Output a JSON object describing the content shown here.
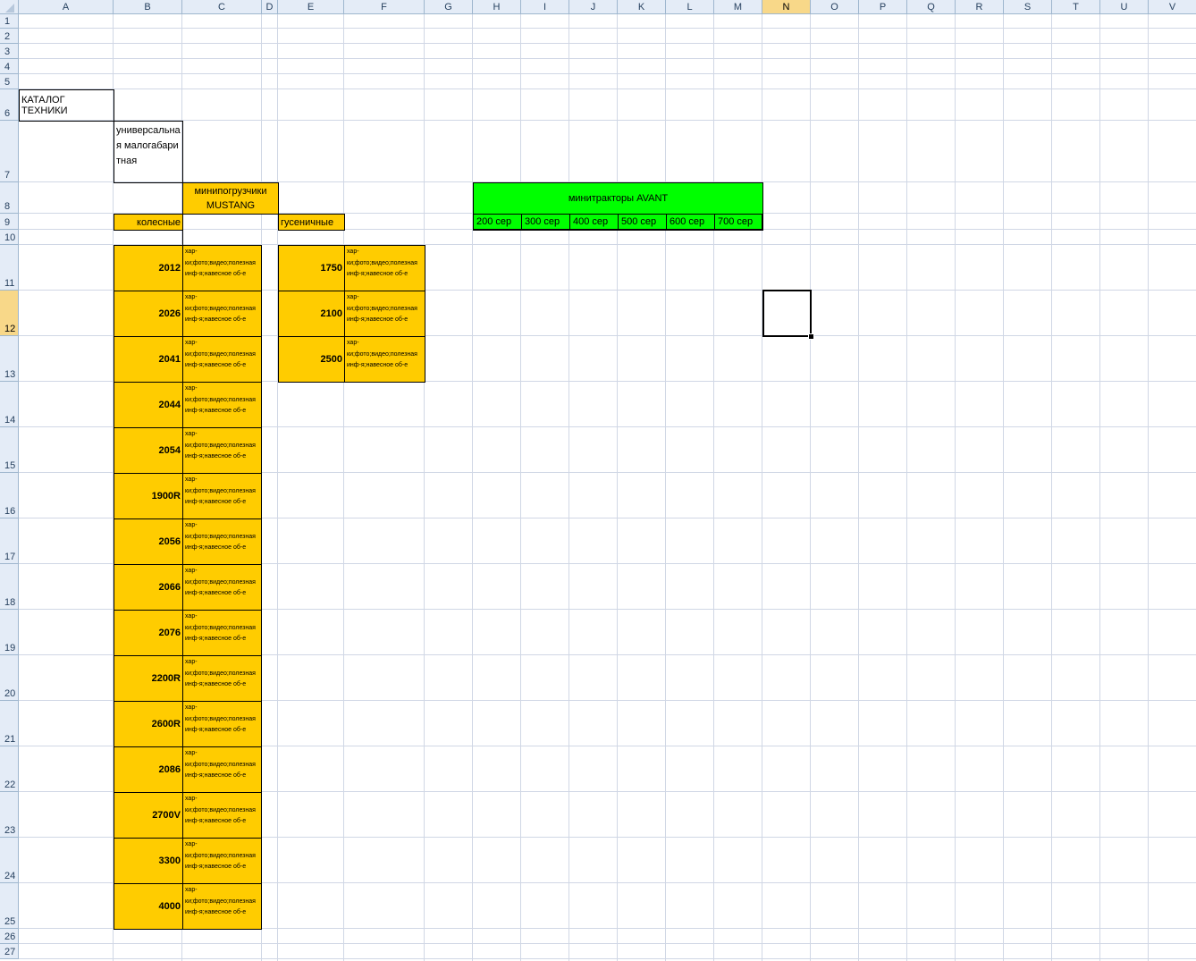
{
  "sheet": {
    "columns": [
      "A",
      "B",
      "C",
      "D",
      "E",
      "F",
      "G",
      "H",
      "I",
      "J",
      "K",
      "L",
      "M",
      "N",
      "O",
      "P",
      "Q",
      "R",
      "S",
      "T",
      "U",
      "V"
    ],
    "rows": [
      "1",
      "2",
      "3",
      "4",
      "5",
      "6",
      "7",
      "8",
      "9",
      "10",
      "11",
      "12",
      "13",
      "14",
      "15",
      "16",
      "17",
      "18",
      "19",
      "20",
      "21",
      "22",
      "23",
      "24",
      "25",
      "26",
      "27"
    ],
    "active_column": "N",
    "active_row": "12"
  },
  "catalog": {
    "title": "КАТАЛОГ ТЕХНИКИ",
    "universal": "универсальная малогабаритная",
    "loaders_header": "минипогрузчики MUSTANG",
    "wheeled_label": "колесные",
    "tracked_label": "гусеничные",
    "info_text": "хар-ки;фото;видео;полезная инф-я;навесное об-е",
    "info_text_tracked": "хар-ки;фото;видео;полезная инф-я;навесное об-е",
    "wheeled_models": [
      "2012",
      "2026",
      "2041",
      "2044",
      "2054",
      "1900R",
      "2056",
      "2066",
      "2076",
      "2200R",
      "2600R",
      "2086",
      "2700V",
      "3300",
      "4000"
    ],
    "tracked_models": [
      "1750",
      "2100",
      "2500"
    ]
  },
  "avant": {
    "header": "минитракторы AVANT",
    "series": [
      "200 сер",
      "300 сер",
      "400 сер",
      "500 сер",
      "600 сер",
      "700 сер"
    ]
  },
  "colors": {
    "orange": "#ffcc00",
    "green": "#00ff00",
    "header_bg": "#e4ecf7",
    "active_header": "#f8d889",
    "grid": "#d0d7e5"
  }
}
